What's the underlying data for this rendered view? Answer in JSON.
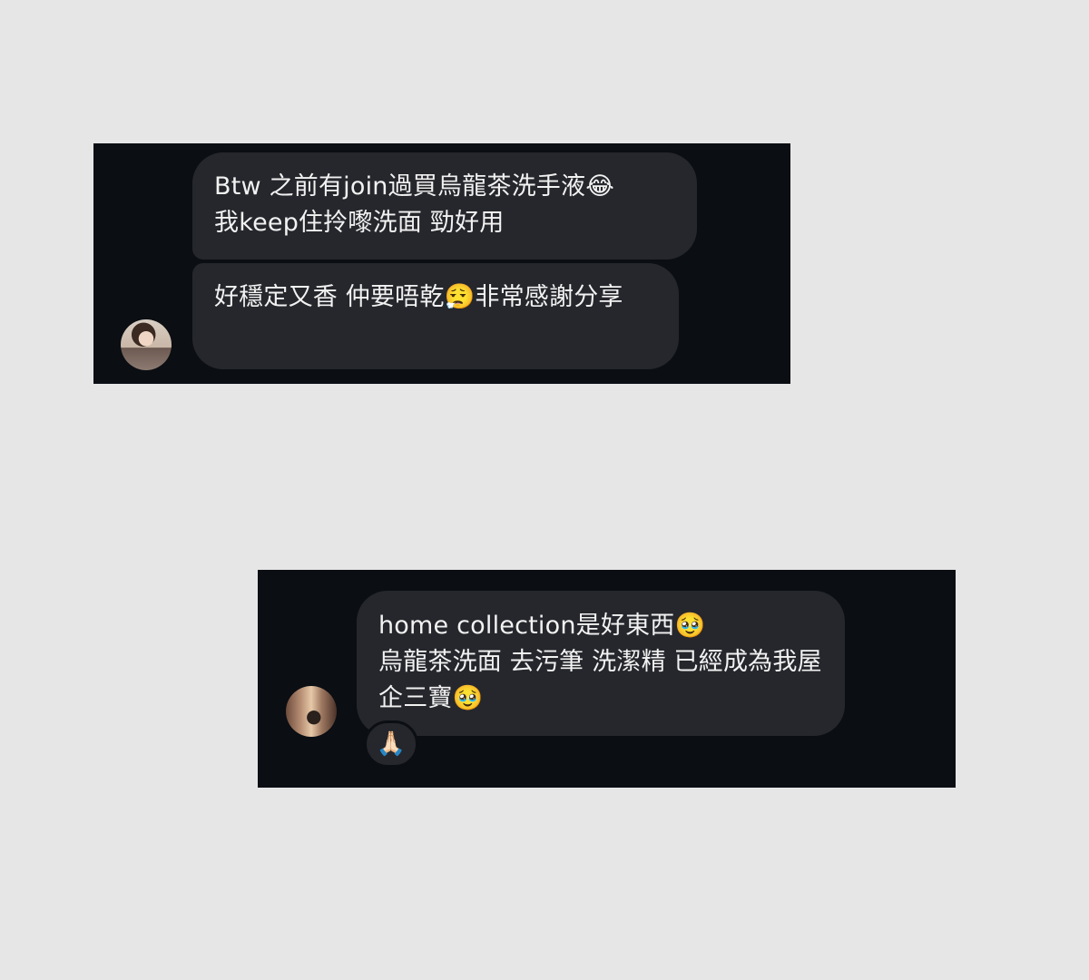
{
  "conversation_1": {
    "messages": [
      {
        "text": "Btw 之前有join過買烏龍茶洗手液😂\n我keep住拎嚟洗面 勁好用"
      },
      {
        "text": "好穩定又香 仲要唔乾😮‍💨非常感謝分享"
      }
    ]
  },
  "conversation_2": {
    "messages": [
      {
        "text": "home collection是好東西🥹\n烏龍茶洗面 去污筆 洗潔精 已經成為我屋企三寶🥹"
      }
    ],
    "reaction": "🙏🏻"
  },
  "colors": {
    "page_background": "#e6e6e6",
    "panel_background": "#0b0e13",
    "bubble_background": "#25272c",
    "text": "#f2f2f2"
  }
}
